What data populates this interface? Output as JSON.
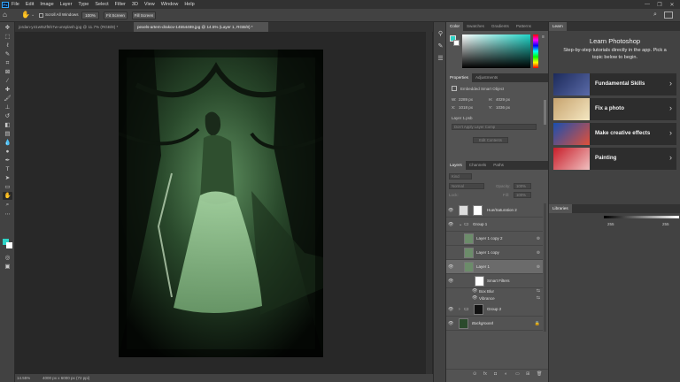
{
  "menu": [
    "File",
    "Edit",
    "Image",
    "Layer",
    "Type",
    "Select",
    "Filter",
    "3D",
    "View",
    "Window",
    "Help"
  ],
  "window_controls": [
    "—",
    "❐",
    "✕"
  ],
  "options": {
    "scroll_all_windows": "Scroll All Windows",
    "zoom_pct": "100%",
    "fit_screen": "Fit Screen",
    "fill_screen": "Fill Screen"
  },
  "tabs": [
    {
      "label": "jordan-y41wt5Zf6h7w-unsplash.jpg @ 11.7% (RGB/8) *",
      "active": false
    },
    {
      "label": "pexels-artem-drakov-14554489.jpg @ 14.5% (Layer 1, RGB/8) *",
      "active": true
    }
  ],
  "status": {
    "zoom": "14.55%",
    "doc": "4000 px x 6000 px (72 ppi)"
  },
  "color_panel": {
    "tabs": [
      "Color",
      "Swatches",
      "Gradients",
      "Patterns"
    ],
    "fg": "#2ed3c6",
    "bg": "#ffffff"
  },
  "properties": {
    "tabs": [
      "Properties",
      "Adjustments"
    ],
    "type": "Embedded Smart Object",
    "w_label": "W:",
    "w": "2289 px",
    "h_label": "H:",
    "h": "4029 px",
    "x_label": "X:",
    "x": "1018 px",
    "y_label": "Y:",
    "y": "1036 px",
    "file": "Layer 1.psb",
    "comp": "Don't Apply Layer Comp",
    "edit_btn": "Edit Contents"
  },
  "layers_panel": {
    "tabs": [
      "Layers",
      "Channels",
      "Paths"
    ],
    "filter": "Kind",
    "blend": "Normal",
    "opacity_label": "Opacity:",
    "opacity": "100%",
    "lock_label": "Lock:",
    "fill_label": "Fill:",
    "fill": "100%",
    "layers": [
      {
        "name": "Hue/Saturation 2",
        "indent": 0
      },
      {
        "name": "Group 1",
        "indent": 0
      },
      {
        "name": "Layer 1 copy 2",
        "indent": 1
      },
      {
        "name": "Layer 1 copy",
        "indent": 1
      },
      {
        "name": "Layer 1",
        "indent": 1
      },
      {
        "name": "Smart Filters",
        "indent": 2
      },
      {
        "name": "Box Blur",
        "indent": 2
      },
      {
        "name": "Vibrance",
        "indent": 2
      },
      {
        "name": "Group 2",
        "indent": 0
      },
      {
        "name": "Background",
        "indent": 0
      }
    ]
  },
  "learn": {
    "tab": "Learn",
    "title": "Learn Photoshop",
    "desc": "Step-by-step tutorials directly in the app. Pick a topic below to begin.",
    "cards": [
      "Fundamental Skills",
      "Fix a photo",
      "Make creative effects",
      "Painting"
    ]
  },
  "libraries": {
    "tab": "Libraries",
    "val1": "255",
    "val2": "255"
  }
}
